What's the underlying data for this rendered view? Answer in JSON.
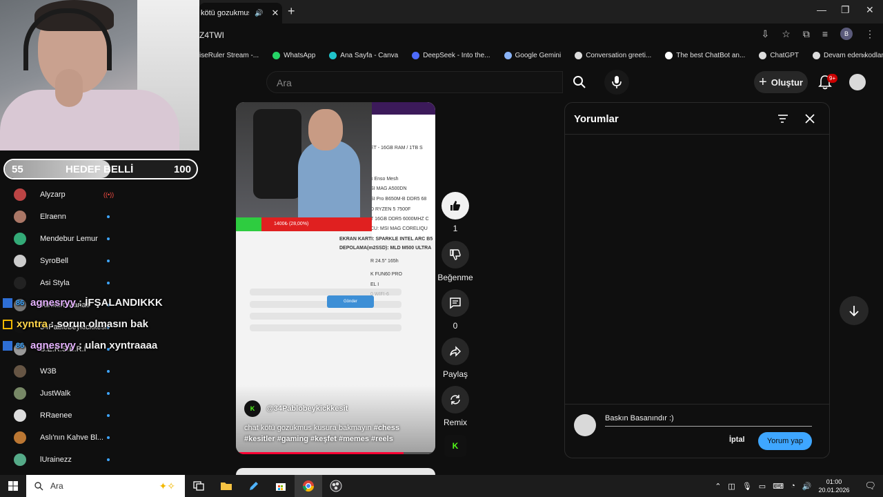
{
  "browser": {
    "tab_title": "kötü gozukmus k",
    "url": "Z4TWI",
    "bookmarks": [
      {
        "label": "iseRuler Stream -...",
        "color": "#3ea6ff"
      },
      {
        "label": "WhatsApp",
        "color": "#25d366"
      },
      {
        "label": "Ana Sayfa - Canva",
        "color": "#20c4cb"
      },
      {
        "label": "DeepSeek - Into the...",
        "color": "#4d6bfe"
      },
      {
        "label": "Google Gemini",
        "color": "#8ab4f8"
      },
      {
        "label": "Conversation greeti...",
        "color": "#dddddd"
      },
      {
        "label": "The best ChatBot an...",
        "color": "#ffffff"
      },
      {
        "label": "ChatGPT",
        "color": "#dddddd"
      },
      {
        "label": "Devam eden kodlama",
        "color": "#dddddd"
      }
    ]
  },
  "goal": {
    "start": "55",
    "title": "HEDEF BELLİ",
    "end": "100",
    "progress": 0.55
  },
  "subscriptions": [
    {
      "name": "Alyzarp",
      "live": true,
      "color": "#b44"
    },
    {
      "name": "Elraenn",
      "live": false,
      "color": "#a76"
    },
    {
      "name": "Mendebur Lemur",
      "live": false,
      "color": "#3a7"
    },
    {
      "name": "SyroBell",
      "live": false,
      "color": "#ccc"
    },
    {
      "name": "Asi Styla",
      "live": false,
      "color": "#222"
    },
    {
      "name": "Tankurt Manas",
      "live": false,
      "color": "#777"
    },
    {
      "name": "34Pablobeykickkesit",
      "live": false,
      "color": "#111"
    },
    {
      "name": "S.E.R.S.E.R.İ",
      "live": false,
      "color": "#999"
    },
    {
      "name": "W3B",
      "live": false,
      "color": "#654"
    },
    {
      "name": "JustWalk",
      "live": false,
      "color": "#786"
    },
    {
      "name": "RRaenee",
      "live": false,
      "color": "#ddd"
    },
    {
      "name": "Aslı'nın Kahve Bl...",
      "live": false,
      "color": "#b73"
    },
    {
      "name": "lUrainezz",
      "live": false,
      "color": "#5a8"
    }
  ],
  "live_label": "((•))",
  "chat": [
    {
      "badge": "blue",
      "user": "agnesryy",
      "message": "İFŞALANDIKKK",
      "user_color": "#e6b3ff"
    },
    {
      "badge": "gold",
      "user": "xyntra",
      "message": "sorun olmasın bak",
      "user_color": "#ffd54a"
    },
    {
      "badge": "blue",
      "user": "agnesryy",
      "message": "ulan xyntraaaa",
      "user_color": "#e6b3ff"
    }
  ],
  "badge_num": "86",
  "youtube": {
    "search_placeholder": "Ara",
    "create_label": "Oluştur",
    "notif_count": "9+"
  },
  "short": {
    "overlay_bar_text": "1400₺ (28,00%)",
    "gonder": "Gönder",
    "specs": [
      "ET - 16GB RAM / 1TB S",
      "x Enso Mesh",
      "SI MAG A500DN",
      "SI Pro B650M-B DDR5 68",
      "D RYZEN 5 7500F",
      "T 16GB DDR5 6000MHZ C",
      "CU: MSI MAG CORELIQU",
      "EKRAN KARTI: SPARKLE INTEL ARC B5",
      "DEPOLAMA(m2SSD): MLD M500 ULTRA",
      "R 24.5\" 165h",
      "K FUN60 PRO",
      "EL I",
      "0 WIFI-6"
    ],
    "channel": "@34Pablobeykickkesit",
    "caption_text": "chat kötü gozukmus kusura bakmayın",
    "hashtags": "#chess #kesitler #gaming  #keşfet #memes #reels",
    "progress": 0.84
  },
  "actions": {
    "like_count": "1",
    "dislike_label": "Beğenme",
    "comment_count": "0",
    "share_label": "Paylaş",
    "remix_label": "Remix"
  },
  "comments": {
    "title": "Yorumlar",
    "input_value": "Baskın Basanındır :)",
    "cancel_label": "İptal",
    "post_label": "Yorum yap"
  },
  "taskbar": {
    "search_placeholder": "Ara",
    "time": "01:00",
    "date": "20.01.2026"
  }
}
